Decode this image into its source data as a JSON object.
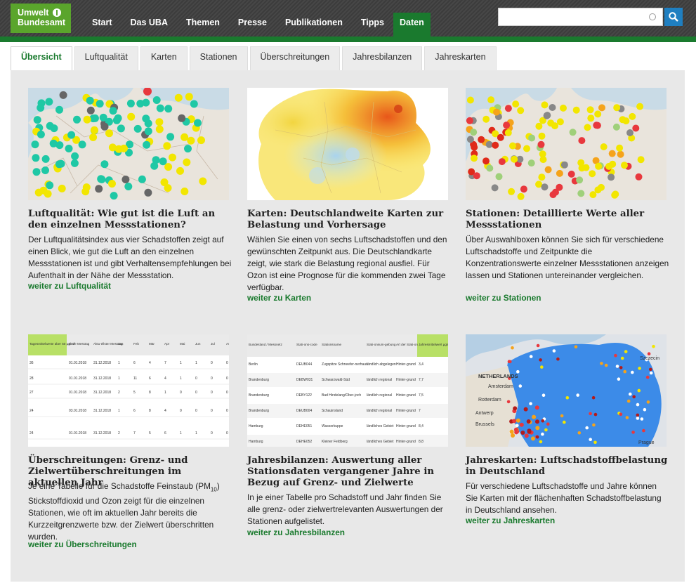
{
  "logo": {
    "line1": "Umwelt",
    "line2": "Bundesamt"
  },
  "nav": [
    "Start",
    "Das UBA",
    "Themen",
    "Presse",
    "Publikationen",
    "Tipps",
    "Daten"
  ],
  "search": {
    "value": ""
  },
  "tabs": [
    "Übersicht",
    "Luftqualität",
    "Karten",
    "Stationen",
    "Überschreitungen",
    "Jahresbilanzen",
    "Jahreskarten"
  ],
  "cards": [
    {
      "title": "Luftqualität: Wie gut ist die Luft an den einzelnen Messstationen?",
      "text": "Der Luftqualitätsindex aus vier Schadstoffen zeigt auf einen Blick, wie gut die Luft an den einzelnen Messstationen ist und gibt Verhaltensempfehlungen bei Aufenthalt in der Nähe der Messstation.",
      "link": "weiter zu Luftqualität"
    },
    {
      "title": "Karten: Deutschlandweite Karten zur Belastung und Vorhersage",
      "text": "Wählen Sie einen von sechs Luftschadstoffen und den gewünschten Zeitpunkt aus. Die Deutschlandkarte zeigt, wie stark die Belastung regional ausfiel. Für Ozon ist eine Prognose für die kommenden zwei Tage verfügbar.",
      "link": "weiter zu Karten"
    },
    {
      "title": "Stationen: Detaillierte Werte aller Messstationen",
      "text": "Über Auswahlboxen können Sie sich für verschiedene Luftschadstoffe und Zeitpunkte die Konzentrationswerte einzelner Messstationen anzeigen lassen und Stationen untereinander vergleichen.",
      "link": "weiter zu Stationen"
    },
    {
      "title": "Überschreitungen: Grenz- und Zielwertüberschreitungen im aktuellen Jahr",
      "text_pre": "Je eine Tabelle für die Schadstoffe Feinstaub (PM",
      "text_sub": "10",
      "text_post": ") Stickstoffdioxid und Ozon zeigt für die einzelnen Stationen, wie oft im aktuellen Jahr bereits die Kurzzeitgrenzwerte bzw. der Zielwert überschritten wurden.",
      "link": "weiter zu Überschreitungen"
    },
    {
      "title": "Jahresbilanzen: Auswertung aller Stationsdaten vergangener Jahre in Bezug auf Grenz- und Zielwerte",
      "text": "In je einer Tabelle pro Schadstoff und Jahr finden Sie alle grenz- oder zielwertrelevanten Auswertungen der Stationen aufgelistet.",
      "link": "weiter zu Jahresbilanzen"
    },
    {
      "title": "Jahreskarten: Luftschadstoffbelastung in Deutschland",
      "text": "Für verschiedene Luftschadstoffe und Jahre können Sie Karten mit der flächenhaften Schadstoffbelastung in Deutschland ansehen.",
      "link": "weiter zu Jahreskarten"
    }
  ],
  "exceed_table": {
    "headers": [
      "Tagesmittelwerte über 50 µg/m³",
      "Ende Messtag",
      "Aktu-ellster Messtag",
      "Jan",
      "Feb",
      "Mär",
      "Apr",
      "Mai",
      "Jun",
      "Jul",
      "Aug"
    ],
    "rows": [
      [
        "36",
        "01.01.2018",
        "31.12.2018",
        "1",
        "6",
        "4",
        "7",
        "1",
        "1",
        "0",
        "0"
      ],
      [
        "28",
        "01.01.2018",
        "31.12.2018",
        "1",
        "11",
        "6",
        "4",
        "1",
        "0",
        "0",
        "0"
      ],
      [
        "27",
        "01.01.2018",
        "31.12.2018",
        "2",
        "5",
        "8",
        "1",
        "0",
        "0",
        "0",
        "0"
      ],
      [
        "24",
        "03.01.2018",
        "31.12.2018",
        "1",
        "6",
        "8",
        "4",
        "0",
        "0",
        "0",
        "0"
      ],
      [
        "24",
        "01.01.2018",
        "31.12.2018",
        "2",
        "7",
        "5",
        "6",
        "1",
        "1",
        "0",
        "0"
      ]
    ]
  },
  "balance_table": {
    "headers": [
      "Bundesland / Messnetz",
      "Stati-ons-code",
      "Stationsname",
      "Stati-onsum-gebung",
      "Art der Stati-on",
      "Jahresmittelwert µg/m³"
    ],
    "rows": [
      [
        "Berlin",
        "DEUB044",
        "Zugspitze Schneefer-nerhaus",
        "ländlich abgelegen",
        "Hinter-grund",
        "3,4"
      ],
      [
        "Brandenburg",
        "DEBW031",
        "Schwarzwald-Süd",
        "ländlich regional",
        "Hinter-grund",
        "7,7"
      ],
      [
        "Brandenburg",
        "DEBY122",
        "Bad Hindelang/Ober-joch",
        "ländlich regional",
        "Hinter-grund",
        "7,5"
      ],
      [
        "Brandenburg",
        "DEUB004",
        "Schauinsland",
        "ländlich regional",
        "Hinter-grund",
        "7"
      ],
      [
        "Hamburg",
        "DEHE051",
        "Wasserkuppe",
        "ländliches Gebiet",
        "Hinter-grund",
        "8,4"
      ],
      [
        "Hamburg",
        "DEHE052",
        "Kleiner Feldberg",
        "ländliches Gebiet",
        "Hinter-grund",
        "8,8"
      ]
    ]
  },
  "map6_labels": [
    "Szczecin",
    "NETHERLANDS",
    "Amsterdam",
    "Rotterdam",
    "Antwerp",
    "Brussels",
    "Prague"
  ],
  "colors": {
    "uba_green": "#5aa52c",
    "dark_green": "#1a7a2e",
    "link_green": "#1a7a2e",
    "search_blue": "#1f7fc1"
  }
}
